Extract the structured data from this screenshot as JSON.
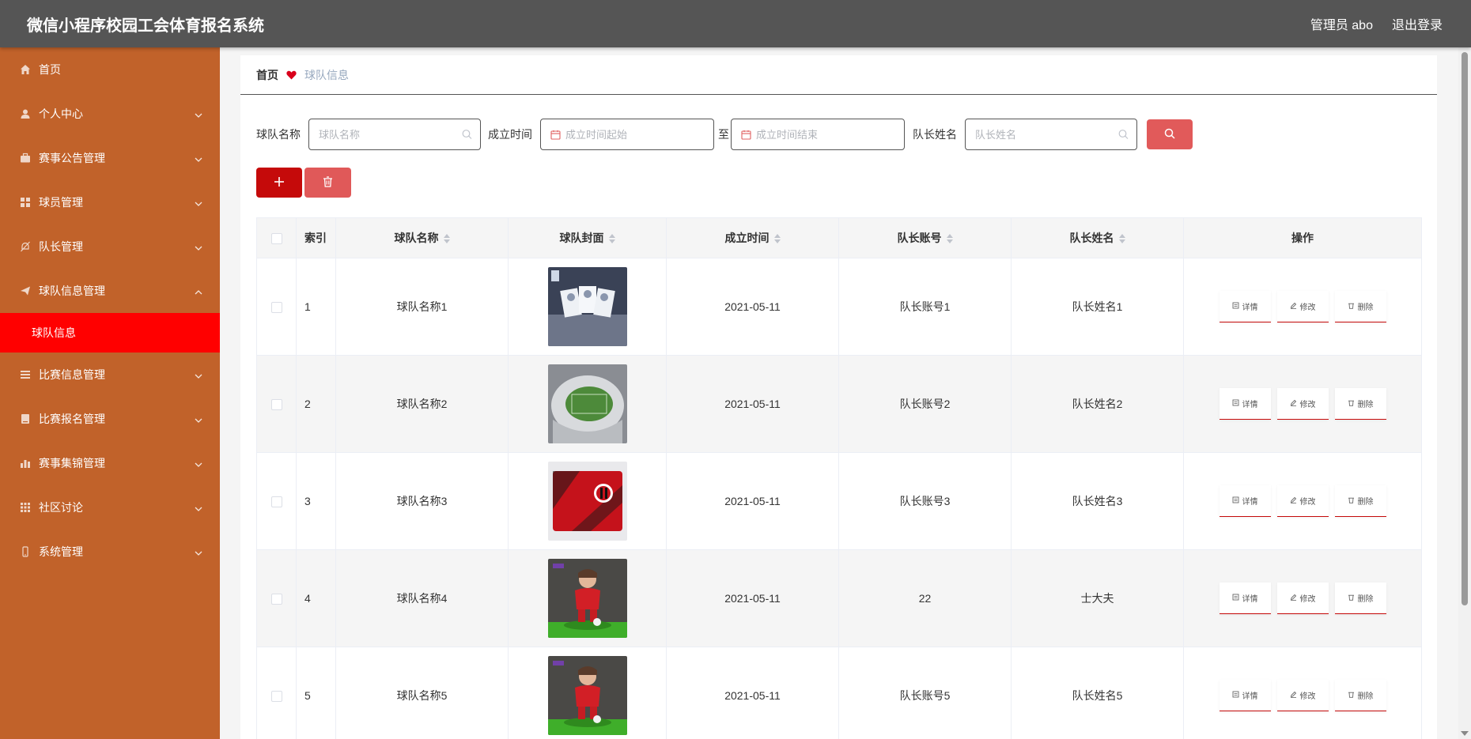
{
  "app": {
    "title": "微信小程序校园工会体育报名系统"
  },
  "header": {
    "user_label": "管理员 abo",
    "logout_label": "退出登录"
  },
  "sidebar": {
    "items": [
      {
        "label": "首页",
        "icon": "home-icon",
        "has_children": false
      },
      {
        "label": "个人中心",
        "icon": "user-icon",
        "has_children": true
      },
      {
        "label": "赛事公告管理",
        "icon": "briefcase-icon",
        "has_children": true
      },
      {
        "label": "球员管理",
        "icon": "grid-icon",
        "has_children": true
      },
      {
        "label": "队长管理",
        "icon": "bell-off-icon",
        "has_children": true
      },
      {
        "label": "球队信息管理",
        "icon": "send-icon",
        "has_children": true,
        "expanded": true
      },
      {
        "label": "比赛信息管理",
        "icon": "list-icon",
        "has_children": true
      },
      {
        "label": "比赛报名管理",
        "icon": "book-icon",
        "has_children": true
      },
      {
        "label": "赛事集锦管理",
        "icon": "chart-icon",
        "has_children": true
      },
      {
        "label": "社区讨论",
        "icon": "apps-icon",
        "has_children": true
      },
      {
        "label": "系统管理",
        "icon": "phone-icon",
        "has_children": true
      }
    ],
    "active_sub": "球队信息"
  },
  "breadcrumb": {
    "home": "首页",
    "current": "球队信息"
  },
  "search": {
    "team_name_label": "球队名称",
    "team_name_placeholder": "球队名称",
    "founded_label": "成立时间",
    "start_placeholder": "成立时间起始",
    "range_sep": "至",
    "end_placeholder": "成立时间结束",
    "captain_name_label": "队长姓名",
    "captain_name_placeholder": "队长姓名"
  },
  "table": {
    "headers": {
      "index": "索引",
      "team_name": "球队名称",
      "cover": "球队封面",
      "founded": "成立时间",
      "captain_account": "队长账号",
      "captain_name": "队长姓名",
      "actions": "操作"
    },
    "action_labels": {
      "detail": "详情",
      "edit": "修改",
      "delete": "删除"
    },
    "rows": [
      {
        "index": "1",
        "team_name": "球队名称1",
        "founded": "2021-05-11",
        "captain_account": "队长账号1",
        "captain_name": "队长姓名1",
        "cover": "cards"
      },
      {
        "index": "2",
        "team_name": "球队名称2",
        "founded": "2021-05-11",
        "captain_account": "队长账号2",
        "captain_name": "队长姓名2",
        "cover": "stadium"
      },
      {
        "index": "3",
        "team_name": "球队名称3",
        "founded": "2021-05-11",
        "captain_account": "队长账号3",
        "captain_name": "队长姓名3",
        "cover": "wallet"
      },
      {
        "index": "4",
        "team_name": "球队名称4",
        "founded": "2021-05-11",
        "captain_account": "22",
        "captain_name": "士大夫",
        "cover": "figure"
      },
      {
        "index": "5",
        "team_name": "球队名称5",
        "founded": "2021-05-11",
        "captain_account": "队长账号5",
        "captain_name": "队长姓名5",
        "cover": "figure"
      }
    ]
  },
  "colors": {
    "topbar": "#555555",
    "sidebar": "#c1622a",
    "active": "#ff0000",
    "primary": "#c50a0a",
    "danger": "#e05959"
  }
}
